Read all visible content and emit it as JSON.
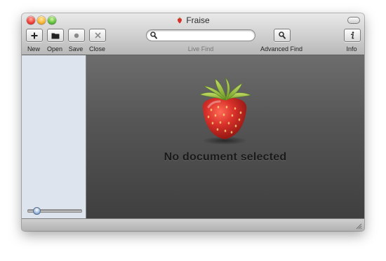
{
  "window": {
    "title": "Fraise"
  },
  "toolbar": {
    "new_label": "New",
    "open_label": "Open",
    "save_label": "Save",
    "close_label": "Close",
    "search_placeholder": "",
    "search_value": "",
    "live_find_label": "Live Find",
    "advanced_find_label": "Advanced Find",
    "info_label": "Info"
  },
  "sidebar": {
    "zoom_slider_level": 0.1
  },
  "main": {
    "empty_message": "No document selected"
  },
  "icons": {
    "app": "strawberry-icon",
    "new": "plus-icon",
    "open": "folder-icon",
    "save": "record-dot-icon",
    "close": "x-icon",
    "search": "magnifier-icon",
    "advanced_find": "magnifier-icon",
    "info": "info-icon"
  },
  "colors": {
    "sidebar_bg": "#dde4ee",
    "content_bg_top": "#6d6d6d",
    "content_bg_bottom": "#3f3f3f",
    "strawberry_red": "#d8302a",
    "leaf_green": "#8fb63a"
  }
}
